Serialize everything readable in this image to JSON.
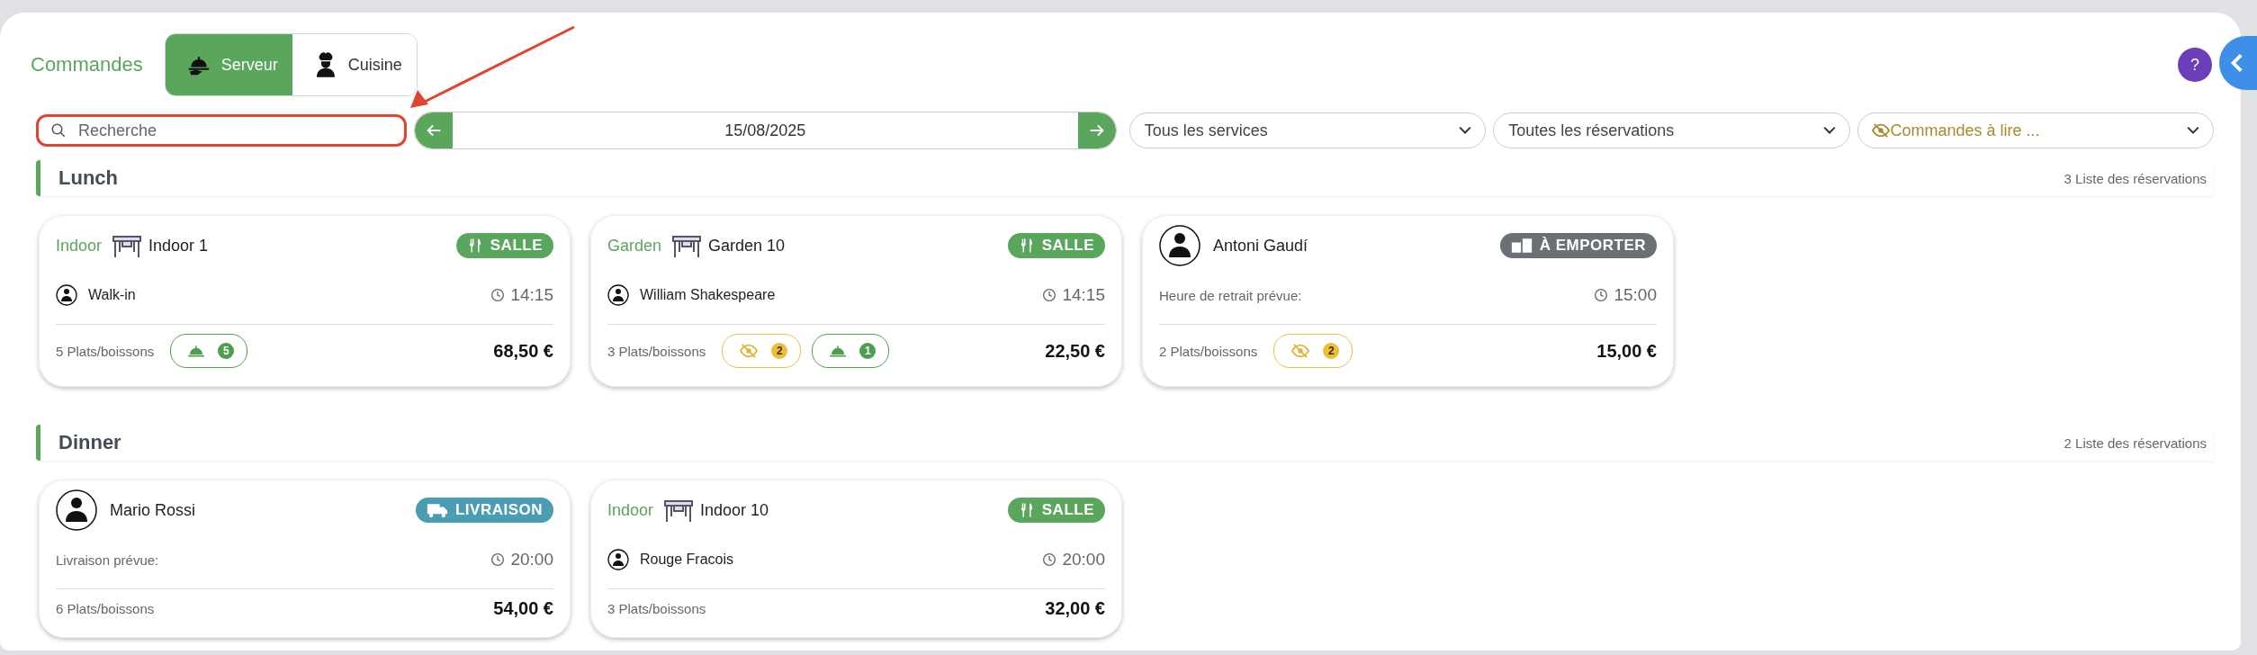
{
  "header": {
    "title": "Commandes",
    "modes": [
      {
        "label": "Serveur",
        "selected": true
      },
      {
        "label": "Cuisine",
        "selected": false
      }
    ]
  },
  "help_button": {
    "label": "?"
  },
  "toolbar": {
    "search": {
      "placeholder": "Recherche"
    },
    "date": "15/08/2025",
    "filters": [
      {
        "value": "Tous les services",
        "kind": "plain"
      },
      {
        "value": "Toutes les réservations",
        "kind": "plain"
      },
      {
        "value": "Commandes à lire ...",
        "kind": "unread"
      }
    ]
  },
  "sections": [
    {
      "title": "Lunch",
      "count": "3 Liste des réservations",
      "cards": [
        {
          "kind": "table",
          "zone": "Indoor",
          "table": "Indoor 1",
          "service": {
            "label": "SALLE",
            "kind": "dine_in"
          },
          "guest": "Walk-in",
          "time": "14:15",
          "items": "5 Plats/boissons",
          "badges": [
            {
              "kind": "served",
              "count": "5"
            }
          ],
          "total": "68,50 €"
        },
        {
          "kind": "table",
          "zone": "Garden",
          "table": "Garden 10",
          "service": {
            "label": "SALLE",
            "kind": "dine_in"
          },
          "guest": "William Shakespeare",
          "time": "14:15",
          "items": "3 Plats/boissons",
          "badges": [
            {
              "kind": "unread",
              "count": "2"
            },
            {
              "kind": "served",
              "count": "1"
            }
          ],
          "total": "22,50 €"
        },
        {
          "kind": "customer",
          "customer": "Antoni Gaudí",
          "service": {
            "label": "À EMPORTER",
            "kind": "takeaway"
          },
          "time_label": "Heure de retrait prévue:",
          "time": "15:00",
          "items": "2 Plats/boissons",
          "badges": [
            {
              "kind": "unread",
              "count": "2"
            }
          ],
          "total": "15,00 €"
        }
      ]
    },
    {
      "title": "Dinner",
      "count": "2 Liste des réservations",
      "cards": [
        {
          "kind": "customer",
          "customer": "Mario Rossi",
          "service": {
            "label": "LIVRAISON",
            "kind": "delivery"
          },
          "time_label": "Livraison prévue:",
          "time": "20:00",
          "items": "6 Plats/boissons",
          "total": "54,00 €"
        },
        {
          "kind": "table",
          "zone": "Indoor",
          "table": "Indoor 10",
          "service": {
            "label": "SALLE",
            "kind": "dine_in"
          },
          "guest": "Rouge Fracois",
          "time": "20:00",
          "items": "3 Plats/boissons",
          "total": "32,00 €"
        }
      ]
    }
  ]
}
